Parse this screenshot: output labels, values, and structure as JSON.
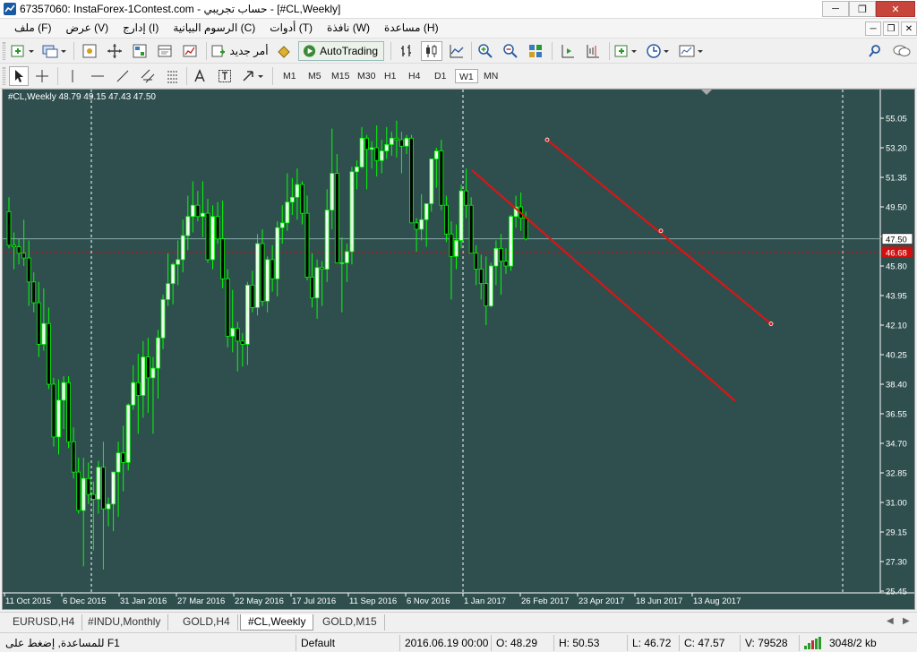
{
  "window": {
    "title": "67357060: InstaForex-1Contest.com - حساب تجريبي - [#CL,Weekly]",
    "controls": {
      "minimize": "─",
      "restore": "❐",
      "close": "✕"
    }
  },
  "menu": {
    "items": [
      "ملف (F)",
      "عرض (V)",
      "إدارج (I)",
      "الرسوم البيانية (C)",
      "أدوات (T)",
      "نافذة (W)",
      "مساعدة (H)"
    ],
    "mdi_controls": {
      "minimize": "─",
      "restore": "❐",
      "close": "✕"
    }
  },
  "toolbar": {
    "new_order_label": "أمر جديد",
    "autotrading_label": "AutoTrading",
    "timeframes": [
      "M1",
      "M5",
      "M15",
      "M30",
      "H1",
      "H4",
      "D1",
      "W1",
      "MN"
    ],
    "active_timeframe": "W1"
  },
  "chart": {
    "header": "#CL,Weekly  48.79 49.15 47.43 47.50",
    "bg_color": "#2f4f4f",
    "bull_color": "#f0fff0",
    "bear_color": "#000000",
    "wick_color": "#00ff00",
    "current_price_label": "47.50",
    "alert_label": "46.68",
    "y_ticks": [
      "55.05",
      "53.20",
      "51.35",
      "49.50",
      "47.65",
      "45.80",
      "43.95",
      "42.10",
      "40.25",
      "38.40",
      "36.55",
      "34.70",
      "32.85",
      "31.00",
      "29.15",
      "27.30",
      "25.45"
    ],
    "x_ticks": [
      "11 Oct 2015",
      "6 Dec 2015",
      "31 Jan 2016",
      "27 Mar 2016",
      "22 May 2016",
      "17 Jul 2016",
      "11 Sep 2016",
      "6 Nov 2016",
      "1 Jan 2017",
      "26 Feb 2017",
      "23 Apr 2017",
      "18 Jun 2017",
      "13 Aug 2017"
    ],
    "channel_color": "#e81010"
  },
  "tabs": {
    "items": [
      "EURUSD,H4",
      "#INDU,Monthly",
      "GOLD,H4",
      "#CL,Weekly",
      "GOLD,M15"
    ],
    "active": "#CL,Weekly"
  },
  "status": {
    "help": "للمساعدة, إضغط على F1",
    "profile": "Default",
    "datetime": "2016.06.19 00:00",
    "open": "O: 48.29",
    "high": "H: 50.53",
    "low": "L: 46.72",
    "close": "C: 47.57",
    "volume": "V: 79528",
    "traffic": "3048/2 kb"
  }
}
